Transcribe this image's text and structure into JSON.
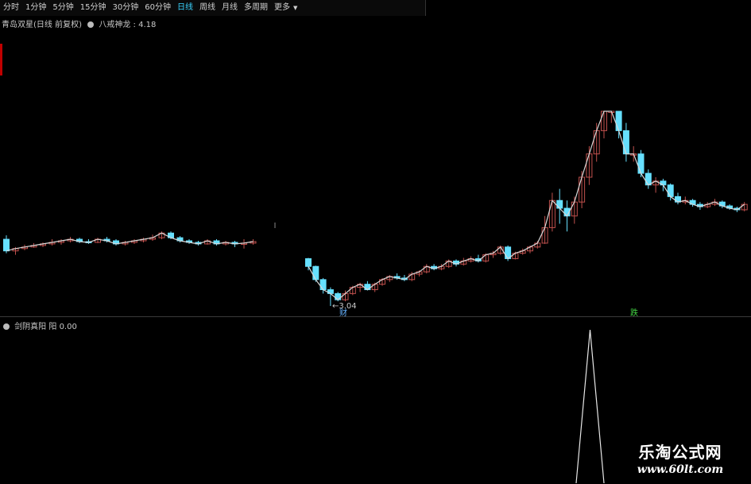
{
  "toolbar": {
    "tabs": [
      {
        "label": "分时",
        "active": false
      },
      {
        "label": "1分钟",
        "active": false
      },
      {
        "label": "5分钟",
        "active": false
      },
      {
        "label": "15分钟",
        "active": false
      },
      {
        "label": "30分钟",
        "active": false
      },
      {
        "label": "60分钟",
        "active": false
      },
      {
        "label": "日线",
        "active": true
      },
      {
        "label": "周线",
        "active": false
      },
      {
        "label": "月线",
        "active": false
      },
      {
        "label": "多周期",
        "active": false
      },
      {
        "label": "更多",
        "active": false
      }
    ],
    "more_arrow": "▼"
  },
  "main_panel": {
    "title": "青岛双星(日线 前复权)",
    "indicator_name": "八戒神龙",
    "indicator_value": "4.18",
    "low_label": "3.04",
    "low_arrow": "←",
    "markers": [
      "财",
      "跌"
    ]
  },
  "sub_panel": {
    "indicator_name": "剑阴真阳 阳",
    "indicator_value": "0.00"
  },
  "watermark": {
    "name": "乐淘公式网",
    "url": "www.60lt.com"
  },
  "colors": {
    "up": "#c0504d",
    "down": "#66e0ff",
    "line": "#d8d8d8",
    "active_tab": "#39d4ff",
    "marker_blue": "#66b3ff",
    "marker_green": "#44d444"
  },
  "chart_data": {
    "type": "candlestick",
    "note_hidden": false,
    "segments": [
      {
        "name": "seg1",
        "candles": [
          [
            3.9,
            3.75,
            3.95,
            3.72
          ],
          [
            3.75,
            3.78,
            3.8,
            3.7
          ],
          [
            3.78,
            3.8,
            3.83,
            3.76
          ],
          [
            3.8,
            3.82,
            3.85,
            3.79
          ],
          [
            3.82,
            3.84,
            3.86,
            3.8
          ],
          [
            3.84,
            3.86,
            3.9,
            3.82
          ],
          [
            3.86,
            3.88,
            3.9,
            3.83
          ],
          [
            3.88,
            3.9,
            3.93,
            3.86
          ],
          [
            3.9,
            3.87,
            3.92,
            3.85
          ],
          [
            3.87,
            3.86,
            3.9,
            3.84
          ],
          [
            3.86,
            3.9,
            3.92,
            3.85
          ],
          [
            3.9,
            3.88,
            3.93,
            3.86
          ],
          [
            3.88,
            3.84,
            3.9,
            3.82
          ],
          [
            3.84,
            3.86,
            3.88,
            3.82
          ],
          [
            3.86,
            3.88,
            3.9,
            3.84
          ],
          [
            3.88,
            3.9,
            3.92,
            3.86
          ],
          [
            3.9,
            3.92,
            3.96,
            3.88
          ],
          [
            3.92,
            3.98,
            4.0,
            3.9
          ],
          [
            3.98,
            3.92,
            4.0,
            3.9
          ],
          [
            3.92,
            3.88,
            3.94,
            3.86
          ],
          [
            3.88,
            3.86,
            3.9,
            3.84
          ],
          [
            3.86,
            3.84,
            3.88,
            3.82
          ],
          [
            3.84,
            3.88,
            3.9,
            3.83
          ],
          [
            3.88,
            3.84,
            3.9,
            3.82
          ],
          [
            3.84,
            3.86,
            3.88,
            3.82
          ],
          [
            3.86,
            3.84,
            3.88,
            3.8
          ],
          [
            3.84,
            3.85,
            3.9,
            3.78
          ],
          [
            3.85,
            3.87,
            3.9,
            3.83
          ]
        ]
      },
      {
        "name": "seg2",
        "candles": [
          [
            3.65,
            3.55,
            3.66,
            3.5
          ],
          [
            3.55,
            3.38,
            3.56,
            3.35
          ],
          [
            3.38,
            3.25,
            3.4,
            3.2
          ],
          [
            3.25,
            3.2,
            3.28,
            3.04
          ],
          [
            3.2,
            3.12,
            3.22,
            3.1
          ],
          [
            3.12,
            3.2,
            3.24,
            3.1
          ],
          [
            3.2,
            3.28,
            3.3,
            3.18
          ],
          [
            3.28,
            3.32,
            3.34,
            3.22
          ],
          [
            3.32,
            3.25,
            3.36,
            3.24
          ],
          [
            3.25,
            3.32,
            3.34,
            3.22
          ],
          [
            3.32,
            3.38,
            3.4,
            3.3
          ],
          [
            3.38,
            3.42,
            3.44,
            3.35
          ],
          [
            3.42,
            3.4,
            3.46,
            3.38
          ],
          [
            3.4,
            3.38,
            3.44,
            3.36
          ],
          [
            3.38,
            3.45,
            3.48,
            3.36
          ],
          [
            3.45,
            3.48,
            3.5,
            3.42
          ],
          [
            3.48,
            3.55,
            3.58,
            3.46
          ],
          [
            3.55,
            3.52,
            3.58,
            3.5
          ],
          [
            3.52,
            3.55,
            3.58,
            3.5
          ],
          [
            3.55,
            3.62,
            3.64,
            3.53
          ],
          [
            3.62,
            3.58,
            3.64,
            3.55
          ],
          [
            3.58,
            3.62,
            3.66,
            3.56
          ],
          [
            3.62,
            3.65,
            3.68,
            3.6
          ],
          [
            3.65,
            3.62,
            3.7,
            3.6
          ],
          [
            3.62,
            3.7,
            3.72,
            3.6
          ],
          [
            3.7,
            3.72,
            3.75,
            3.66
          ],
          [
            3.72,
            3.8,
            3.82,
            3.7
          ],
          [
            3.8,
            3.65,
            3.82,
            3.62
          ],
          [
            3.65,
            3.72,
            3.74,
            3.64
          ],
          [
            3.72,
            3.75,
            3.78,
            3.7
          ],
          [
            3.75,
            3.8,
            3.82,
            3.72
          ],
          [
            3.8,
            3.85,
            3.88,
            3.78
          ],
          [
            3.85,
            4.05,
            4.2,
            3.84
          ],
          [
            4.05,
            4.4,
            4.5,
            4.0
          ],
          [
            4.4,
            4.3,
            4.55,
            4.1
          ],
          [
            4.3,
            4.2,
            4.4,
            4.0
          ],
          [
            4.2,
            4.38,
            4.45,
            4.1
          ],
          [
            4.38,
            4.7,
            4.78,
            4.3
          ],
          [
            4.7,
            5.0,
            5.1,
            4.6
          ],
          [
            5.0,
            5.3,
            5.4,
            4.9
          ],
          [
            5.3,
            5.6,
            5.7,
            5.2
          ],
          [
            5.6,
            5.6,
            5.8,
            5.4
          ],
          [
            5.6,
            5.3,
            5.7,
            5.2
          ],
          [
            5.3,
            5.0,
            5.4,
            4.9
          ],
          [
            5.0,
            5.0,
            5.1,
            4.9
          ],
          [
            5.0,
            4.75,
            5.05,
            4.7
          ],
          [
            4.75,
            4.6,
            4.8,
            4.55
          ],
          [
            4.6,
            4.65,
            4.7,
            4.5
          ],
          [
            4.65,
            4.6,
            4.68,
            4.52
          ],
          [
            4.6,
            4.45,
            4.62,
            4.4
          ],
          [
            4.45,
            4.38,
            4.5,
            4.35
          ],
          [
            4.38,
            4.4,
            4.45,
            4.35
          ],
          [
            4.4,
            4.35,
            4.42,
            4.32
          ],
          [
            4.35,
            4.32,
            4.38,
            4.28
          ],
          [
            4.32,
            4.35,
            4.38,
            4.3
          ],
          [
            4.35,
            4.38,
            4.42,
            4.33
          ],
          [
            4.38,
            4.33,
            4.4,
            4.3
          ],
          [
            4.33,
            4.3,
            4.35,
            4.28
          ],
          [
            4.3,
            4.28,
            4.32,
            4.25
          ],
          [
            4.28,
            4.35,
            4.38,
            4.26
          ]
        ]
      }
    ],
    "sub_series": {
      "values": [
        0,
        0,
        0,
        0,
        1,
        0,
        0,
        0,
        0,
        0,
        0,
        0,
        0,
        0,
        0,
        0,
        0,
        0,
        0,
        0
      ],
      "ylim": [
        0,
        1
      ]
    }
  }
}
